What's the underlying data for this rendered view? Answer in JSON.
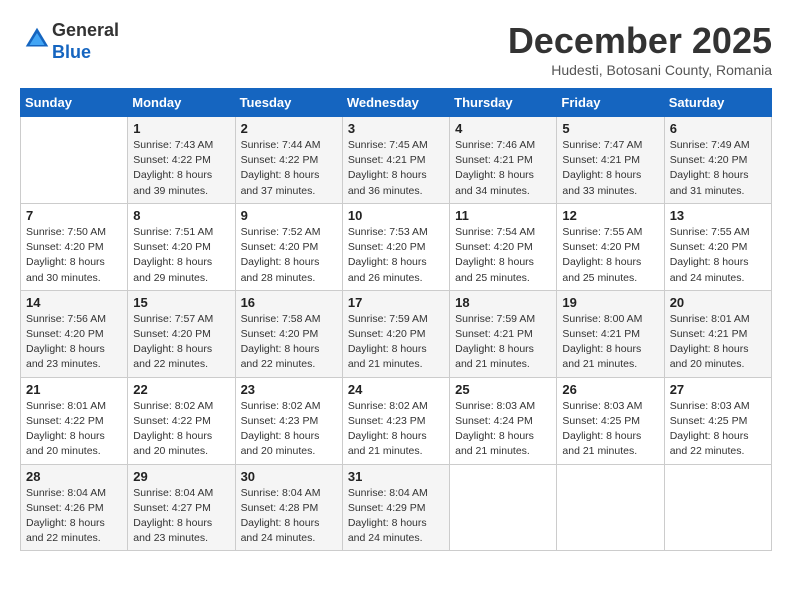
{
  "logo": {
    "general": "General",
    "blue": "Blue"
  },
  "title": "December 2025",
  "subtitle": "Hudesti, Botosani County, Romania",
  "days_of_week": [
    "Sunday",
    "Monday",
    "Tuesday",
    "Wednesday",
    "Thursday",
    "Friday",
    "Saturday"
  ],
  "weeks": [
    [
      {
        "day": "",
        "info": ""
      },
      {
        "day": "1",
        "info": "Sunrise: 7:43 AM\nSunset: 4:22 PM\nDaylight: 8 hours\nand 39 minutes."
      },
      {
        "day": "2",
        "info": "Sunrise: 7:44 AM\nSunset: 4:22 PM\nDaylight: 8 hours\nand 37 minutes."
      },
      {
        "day": "3",
        "info": "Sunrise: 7:45 AM\nSunset: 4:21 PM\nDaylight: 8 hours\nand 36 minutes."
      },
      {
        "day": "4",
        "info": "Sunrise: 7:46 AM\nSunset: 4:21 PM\nDaylight: 8 hours\nand 34 minutes."
      },
      {
        "day": "5",
        "info": "Sunrise: 7:47 AM\nSunset: 4:21 PM\nDaylight: 8 hours\nand 33 minutes."
      },
      {
        "day": "6",
        "info": "Sunrise: 7:49 AM\nSunset: 4:20 PM\nDaylight: 8 hours\nand 31 minutes."
      }
    ],
    [
      {
        "day": "7",
        "info": "Sunrise: 7:50 AM\nSunset: 4:20 PM\nDaylight: 8 hours\nand 30 minutes."
      },
      {
        "day": "8",
        "info": "Sunrise: 7:51 AM\nSunset: 4:20 PM\nDaylight: 8 hours\nand 29 minutes."
      },
      {
        "day": "9",
        "info": "Sunrise: 7:52 AM\nSunset: 4:20 PM\nDaylight: 8 hours\nand 28 minutes."
      },
      {
        "day": "10",
        "info": "Sunrise: 7:53 AM\nSunset: 4:20 PM\nDaylight: 8 hours\nand 26 minutes."
      },
      {
        "day": "11",
        "info": "Sunrise: 7:54 AM\nSunset: 4:20 PM\nDaylight: 8 hours\nand 25 minutes."
      },
      {
        "day": "12",
        "info": "Sunrise: 7:55 AM\nSunset: 4:20 PM\nDaylight: 8 hours\nand 25 minutes."
      },
      {
        "day": "13",
        "info": "Sunrise: 7:55 AM\nSunset: 4:20 PM\nDaylight: 8 hours\nand 24 minutes."
      }
    ],
    [
      {
        "day": "14",
        "info": "Sunrise: 7:56 AM\nSunset: 4:20 PM\nDaylight: 8 hours\nand 23 minutes."
      },
      {
        "day": "15",
        "info": "Sunrise: 7:57 AM\nSunset: 4:20 PM\nDaylight: 8 hours\nand 22 minutes."
      },
      {
        "day": "16",
        "info": "Sunrise: 7:58 AM\nSunset: 4:20 PM\nDaylight: 8 hours\nand 22 minutes."
      },
      {
        "day": "17",
        "info": "Sunrise: 7:59 AM\nSunset: 4:20 PM\nDaylight: 8 hours\nand 21 minutes."
      },
      {
        "day": "18",
        "info": "Sunrise: 7:59 AM\nSunset: 4:21 PM\nDaylight: 8 hours\nand 21 minutes."
      },
      {
        "day": "19",
        "info": "Sunrise: 8:00 AM\nSunset: 4:21 PM\nDaylight: 8 hours\nand 21 minutes."
      },
      {
        "day": "20",
        "info": "Sunrise: 8:01 AM\nSunset: 4:21 PM\nDaylight: 8 hours\nand 20 minutes."
      }
    ],
    [
      {
        "day": "21",
        "info": "Sunrise: 8:01 AM\nSunset: 4:22 PM\nDaylight: 8 hours\nand 20 minutes."
      },
      {
        "day": "22",
        "info": "Sunrise: 8:02 AM\nSunset: 4:22 PM\nDaylight: 8 hours\nand 20 minutes."
      },
      {
        "day": "23",
        "info": "Sunrise: 8:02 AM\nSunset: 4:23 PM\nDaylight: 8 hours\nand 20 minutes."
      },
      {
        "day": "24",
        "info": "Sunrise: 8:02 AM\nSunset: 4:23 PM\nDaylight: 8 hours\nand 21 minutes."
      },
      {
        "day": "25",
        "info": "Sunrise: 8:03 AM\nSunset: 4:24 PM\nDaylight: 8 hours\nand 21 minutes."
      },
      {
        "day": "26",
        "info": "Sunrise: 8:03 AM\nSunset: 4:25 PM\nDaylight: 8 hours\nand 21 minutes."
      },
      {
        "day": "27",
        "info": "Sunrise: 8:03 AM\nSunset: 4:25 PM\nDaylight: 8 hours\nand 22 minutes."
      }
    ],
    [
      {
        "day": "28",
        "info": "Sunrise: 8:04 AM\nSunset: 4:26 PM\nDaylight: 8 hours\nand 22 minutes."
      },
      {
        "day": "29",
        "info": "Sunrise: 8:04 AM\nSunset: 4:27 PM\nDaylight: 8 hours\nand 23 minutes."
      },
      {
        "day": "30",
        "info": "Sunrise: 8:04 AM\nSunset: 4:28 PM\nDaylight: 8 hours\nand 24 minutes."
      },
      {
        "day": "31",
        "info": "Sunrise: 8:04 AM\nSunset: 4:29 PM\nDaylight: 8 hours\nand 24 minutes."
      },
      {
        "day": "",
        "info": ""
      },
      {
        "day": "",
        "info": ""
      },
      {
        "day": "",
        "info": ""
      }
    ]
  ]
}
